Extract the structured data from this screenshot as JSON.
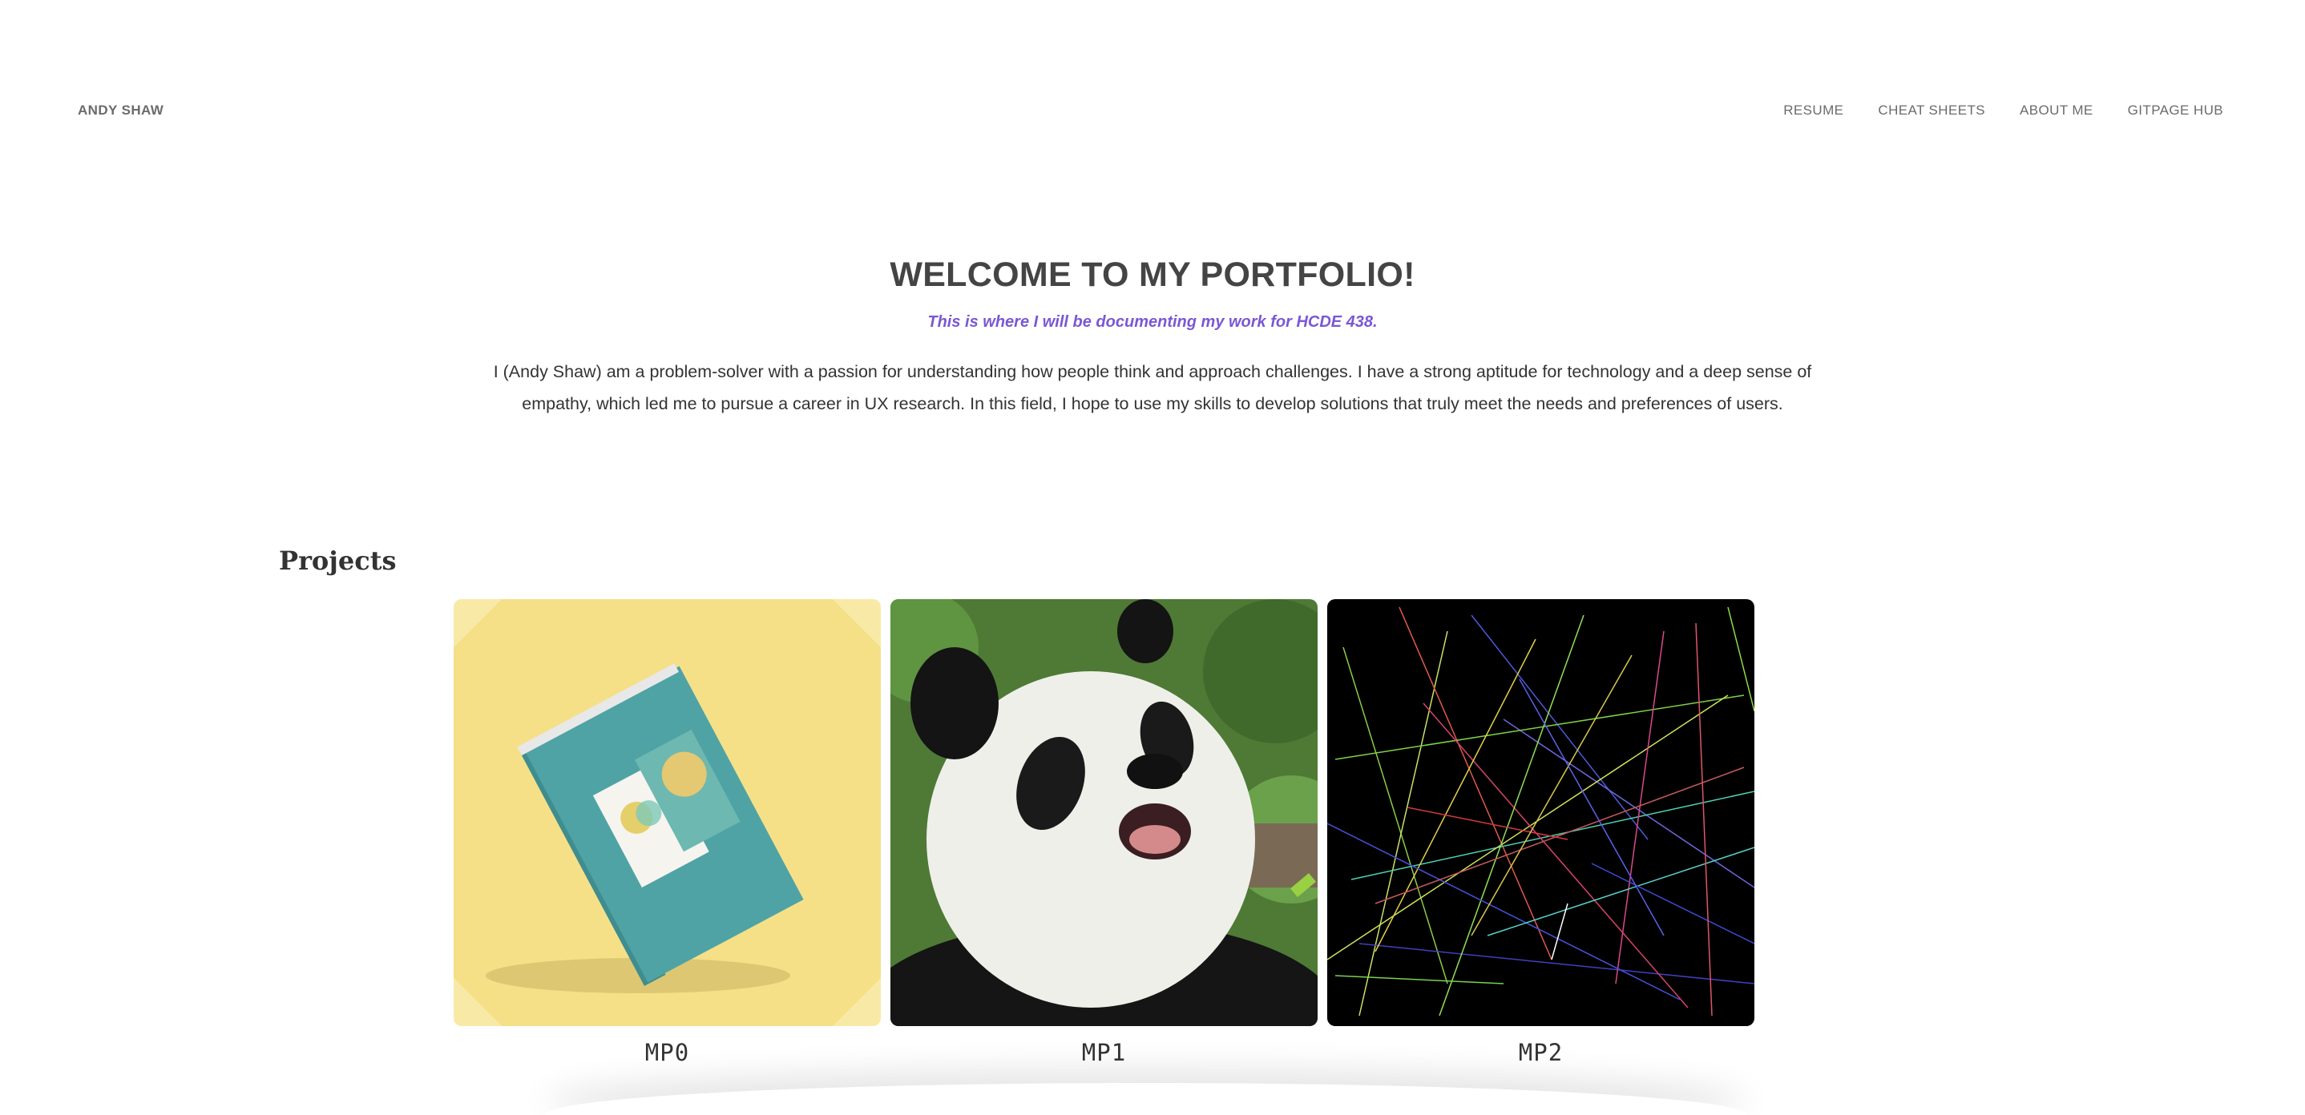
{
  "header": {
    "brand": "ANDY SHAW",
    "nav": [
      {
        "label": "RESUME"
      },
      {
        "label": "CHEAT SHEETS"
      },
      {
        "label": "ABOUT ME"
      },
      {
        "label": "GITPAGE HUB"
      }
    ]
  },
  "hero": {
    "title": "WELCOME TO MY PORTFOLIO!",
    "subtitle": "This is where I will be documenting my work for HCDE 438.",
    "body": "I (Andy Shaw) am a problem-solver with a passion for understanding how people think and approach challenges. I have a strong aptitude for technology and a deep sense of empathy, which led me to pursue a career in UX research. In this field, I hope to use my skills to develop solutions that truly meet the needs and preferences of users."
  },
  "projects": {
    "heading": "Projects",
    "items": [
      {
        "label": "MP0",
        "image": "book-mockup-image"
      },
      {
        "label": "MP1",
        "image": "panda-photo-image"
      },
      {
        "label": "MP2",
        "image": "random-lines-art-image"
      }
    ]
  },
  "colors": {
    "subtitle_accent": "#7a58d4",
    "nav_text": "#6b6b6b",
    "heading_text": "#444444"
  }
}
